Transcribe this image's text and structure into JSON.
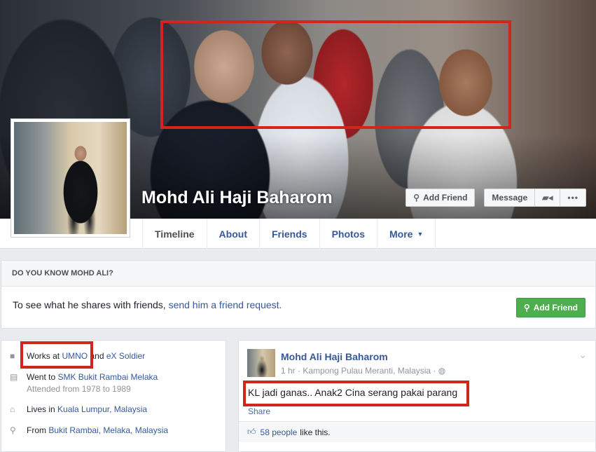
{
  "profile": {
    "name": "Mohd Ali Haji Baharom"
  },
  "cover_actions": {
    "add_friend": "Add Friend",
    "message": "Message",
    "video_icon": "video-camera-icon",
    "more_icon": "more-dots-icon"
  },
  "nav": {
    "tabs": [
      "Timeline",
      "About",
      "Friends",
      "Photos",
      "More"
    ]
  },
  "know": {
    "header": "DO YOU KNOW MOHD ALI?",
    "text": "To see what he shares with friends, ",
    "link": "send him a friend request.",
    "button": "Add Friend"
  },
  "intro": {
    "work_prefix": "Works at ",
    "work_link": "UMNO",
    "work_and": " and ",
    "work_link2": "eX Soldier",
    "school_prefix": "Went to ",
    "school_link": "SMK Bukit Rambai Melaka",
    "school_sub": "Attended from 1978 to 1989",
    "lives_prefix": "Lives in ",
    "lives_link": "Kuala Lumpur, Malaysia",
    "from_prefix": "From ",
    "from_link": "Bukit Rambai, Melaka, Malaysia"
  },
  "post": {
    "author": "Mohd Ali Haji Baharom",
    "meta": "1 hr · Kampong Pulau Meranti, Malaysia · ",
    "text": "KL jadi ganas.. Anak2 Cina serang pakai parang",
    "share": "Share",
    "likes_count": "58 people",
    "likes_suffix": " like this."
  },
  "colors": {
    "highlight": "#d1261b",
    "link": "#365899",
    "green_button": "#4cae4c"
  }
}
